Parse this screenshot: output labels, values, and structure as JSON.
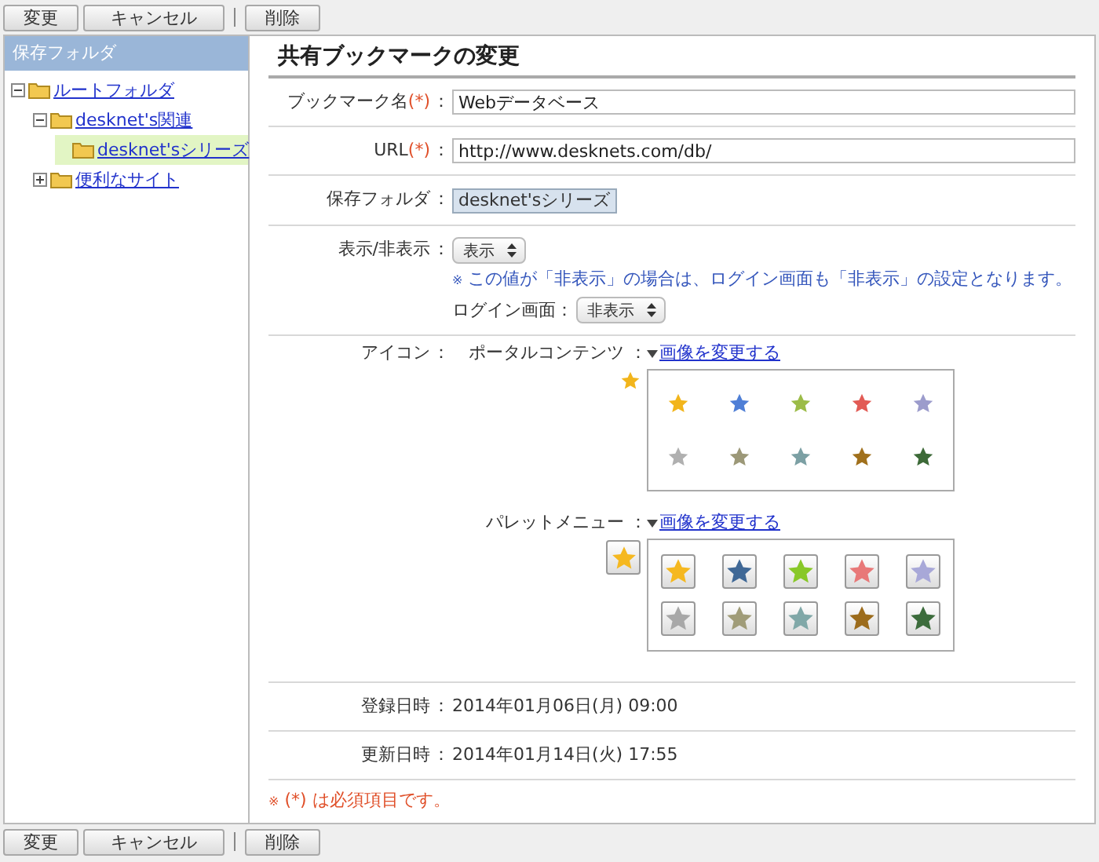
{
  "top_toolbar": {
    "items": [
      {
        "kind": "button",
        "label": "変更"
      },
      {
        "kind": "button",
        "label": "キャンセル"
      },
      {
        "kind": "separator"
      },
      {
        "kind": "button",
        "label": "削除"
      }
    ]
  },
  "sidebar": {
    "title": "保存フォルダ",
    "tree": [
      {
        "label": "ルートフォルダ",
        "expanded": true,
        "selected": false,
        "children": [
          {
            "label": "desknet's関連",
            "expanded": true,
            "selected": false,
            "children": [
              {
                "label": "desknet'sシリーズ",
                "selected": true
              }
            ]
          },
          {
            "label": "便利なサイト",
            "expanded": false,
            "selected": false
          }
        ]
      }
    ]
  },
  "form": {
    "title": "共有ブックマークの変更",
    "colon": "：",
    "required_mark": "(*)",
    "rows": [
      {
        "kind": "text",
        "label": "ブックマーク名",
        "required": true,
        "value": "Webデータベース"
      },
      {
        "kind": "text",
        "label": "URL",
        "required": true,
        "value": "http://www.desknets.com/db/"
      },
      {
        "kind": "readonly",
        "label": "保存フォルダ",
        "required": false,
        "value": "desknet'sシリーズ"
      },
      {
        "kind": "visibility",
        "label": "表示/非表示",
        "required": false,
        "value": "表示",
        "note_mark": "※",
        "note": "この値が「非表示」の場合は、ログイン画面も「非表示」の設定となります。",
        "login_label": "ログイン画面：",
        "login_value": "非表示"
      },
      {
        "kind": "icons",
        "label": "アイコン",
        "required": false,
        "groups": [
          {
            "kind": "plain",
            "label": "ポータルコンテンツ",
            "link": "画像を変更する",
            "current": {
              "color": "#f2b51c"
            },
            "options": [
              {
                "color": "#f2b51c"
              },
              {
                "color": "#4f7fd6"
              },
              {
                "color": "#9cbc48"
              },
              {
                "color": "#e25b55"
              },
              {
                "color": "#9c9ccc"
              },
              {
                "color": "#b0b0b0"
              },
              {
                "color": "#9c9878"
              },
              {
                "color": "#7ca0a4"
              },
              {
                "color": "#a0701c"
              },
              {
                "color": "#3d6a38"
              }
            ]
          },
          {
            "kind": "boxed",
            "label": "パレットメニュー",
            "link": "画像を変更する",
            "current": {
              "color": "#f5b820"
            },
            "options": [
              {
                "color": "#f5b820"
              },
              {
                "color": "#3f6896"
              },
              {
                "color": "#88c828"
              },
              {
                "color": "#e87878"
              },
              {
                "color": "#a8a8d8"
              },
              {
                "color": "#a8a8a8"
              },
              {
                "color": "#a09c78"
              },
              {
                "color": "#80a8a8"
              },
              {
                "color": "#9c6c1c"
              },
              {
                "color": "#3c6c3c"
              }
            ]
          }
        ]
      },
      {
        "kind": "info",
        "label": "登録日時",
        "required": false,
        "value": "2014年01月06日(月) 09:00"
      },
      {
        "kind": "info",
        "label": "更新日時",
        "required": false,
        "value": "2014年01月14日(火) 17:55"
      }
    ],
    "footnote_mark": "※",
    "footnote": "(*) は必須項目です。"
  },
  "bottom_toolbar": {
    "items": [
      {
        "kind": "button",
        "label": "変更"
      },
      {
        "kind": "button",
        "label": "キャンセル"
      },
      {
        "kind": "separator"
      },
      {
        "kind": "button",
        "label": "削除"
      }
    ]
  }
}
